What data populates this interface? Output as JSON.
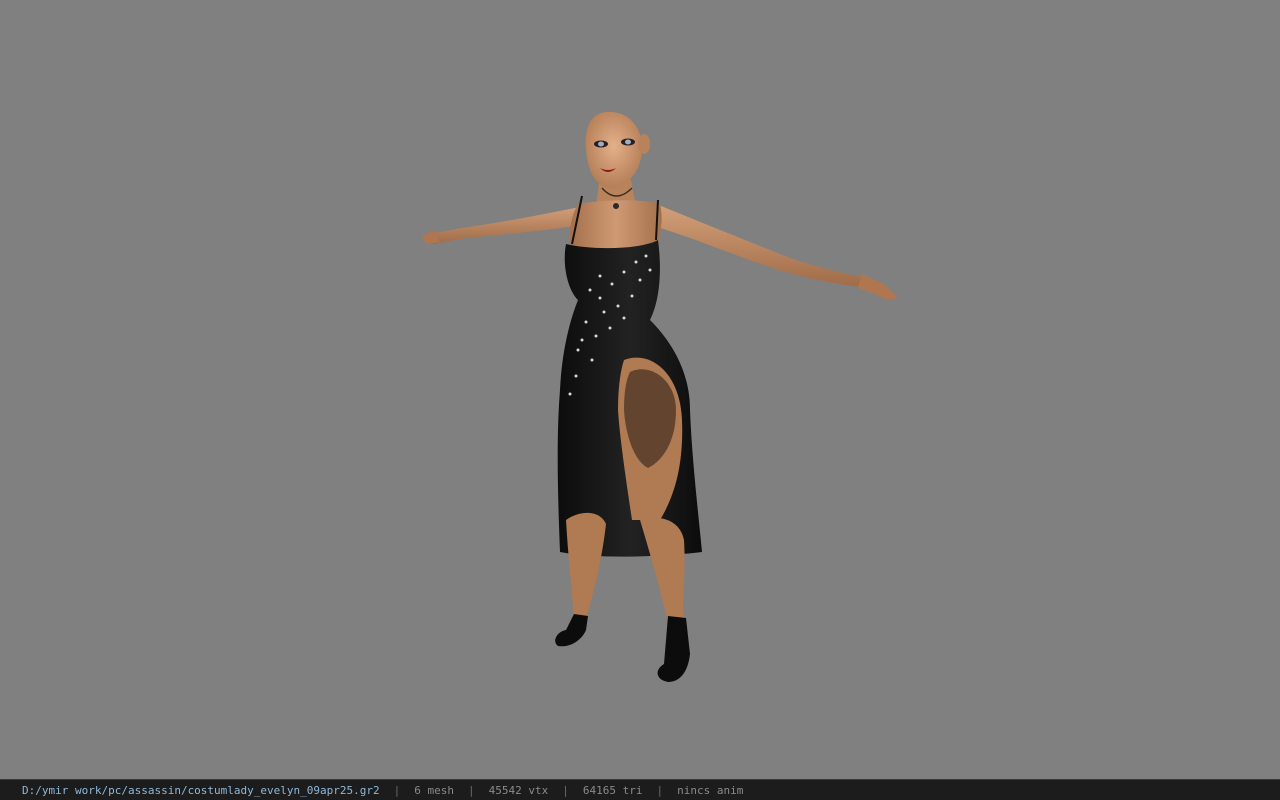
{
  "viewport": {
    "background_color": "#808080",
    "model": "costumlady_evelyn"
  },
  "status_bar": {
    "file_path": "D:/ymir work/pc/assassin/costumlady_evelyn_09apr25.gr2",
    "separator": "|",
    "mesh_count": "6 mesh",
    "vertex_count": "45542 vtx",
    "triangle_count": "64165 tri",
    "animation": "nincs anim",
    "path_color": "#8fb8d8",
    "text_color": "#8a8a8a"
  }
}
